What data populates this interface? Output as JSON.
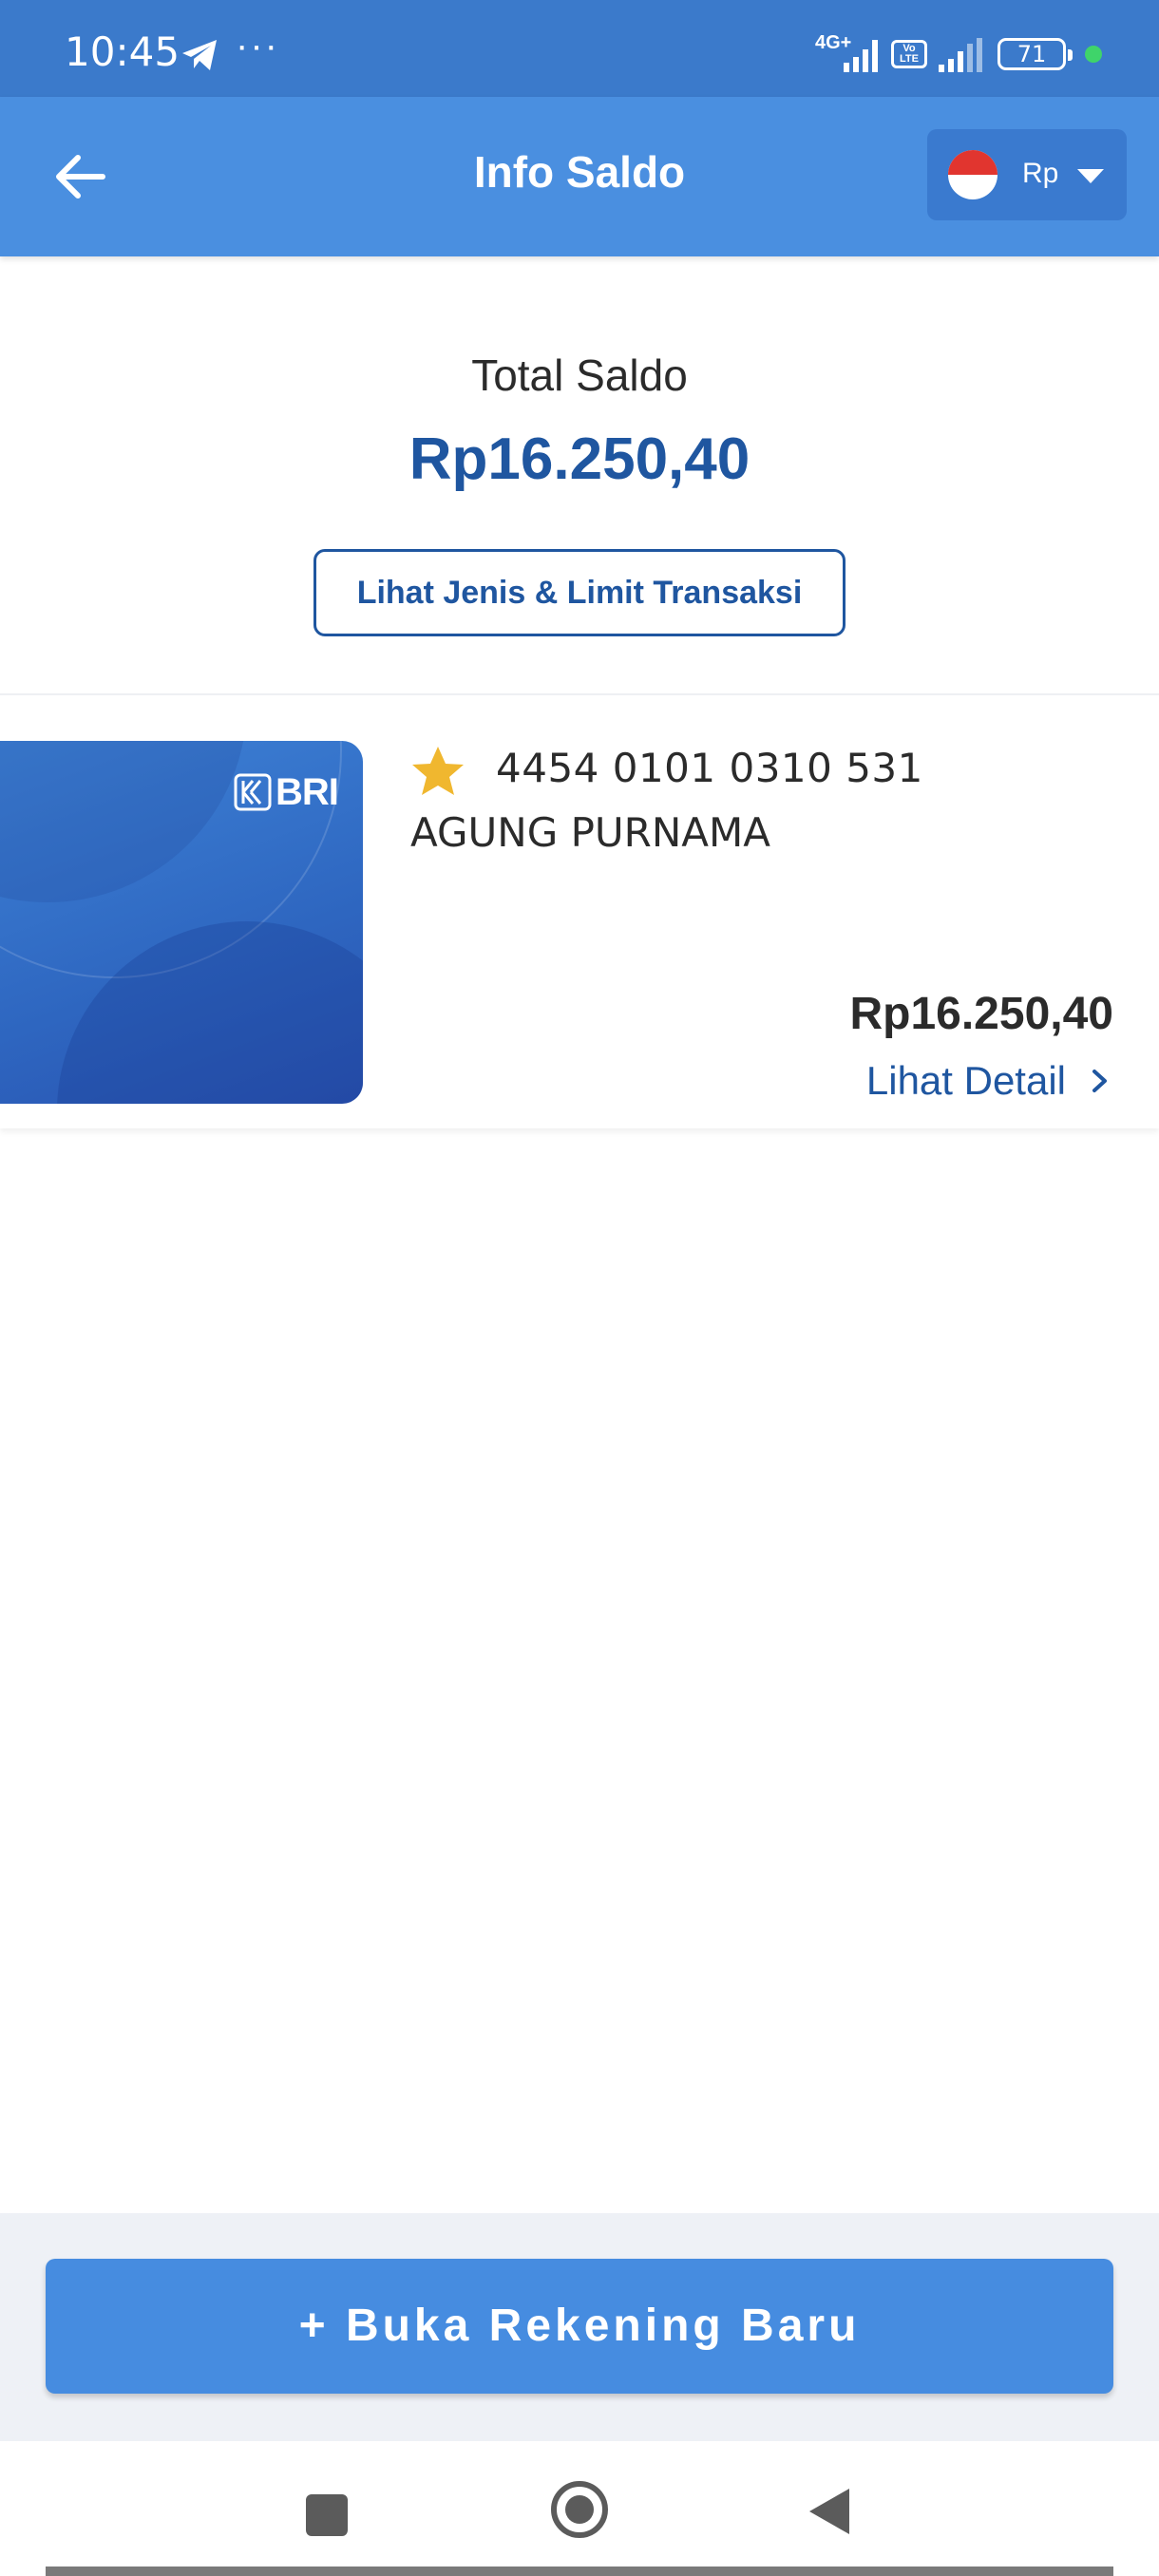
{
  "status_bar": {
    "time": "10:45",
    "dots": "···",
    "network": "4G+",
    "volte": "Vo LTE",
    "battery": "71"
  },
  "header": {
    "title": "Info Saldo",
    "currency": "Rp",
    "flag": "indonesia-flag"
  },
  "summary": {
    "label": "Total Saldo",
    "amount": "Rp16.250,40",
    "limit_button": "Lihat Jenis & Limit Transaksi"
  },
  "account": {
    "bank_logo": "BRI",
    "number": "4454 0101 0310 531",
    "holder": "AGUNG PURNAMA",
    "balance": "Rp16.250,40",
    "detail_link": "Lihat Detail",
    "favorite": true
  },
  "actions": {
    "open_account": "+ Buka Rekening Baru"
  },
  "colors": {
    "primary": "#4a8fe0",
    "status_bar": "#3b7acb",
    "text_accent": "#1f56a0",
    "star": "#f0b72f"
  }
}
